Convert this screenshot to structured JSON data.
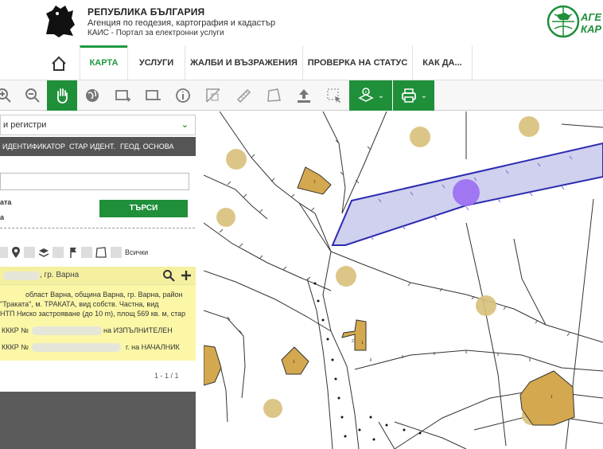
{
  "header": {
    "line1": "РЕПУБЛИКА БЪЛГАРИЯ",
    "line2": "Агенция по геодезия, картография и кадастър",
    "line3": "КАИС - Портал за електронни услуги",
    "brand_text_1": "АГЕ",
    "brand_text_2": "КАР"
  },
  "nav": {
    "items": [
      {
        "label": "КАРТА"
      },
      {
        "label": "УСЛУГИ"
      },
      {
        "label": "ЖАЛБИ И ВЪЗРАЖЕНИЯ"
      },
      {
        "label": "ПРОВЕРКА НА СТАТУС"
      },
      {
        "label": "КАК ДА..."
      }
    ]
  },
  "panel": {
    "dropdown": "и регистри",
    "tabs": [
      "ИДЕНТИФИКАТОР",
      "СТАР ИДЕНТ.",
      "ГЕОД. ОСНОВА"
    ],
    "radio1": "ата",
    "radio2": "а",
    "search_button": "ТЪРСИ",
    "all_label": "Всички",
    "result_title": ", гр. Варна",
    "result_lines": [
      "област Варна, община Варна, гр. Варна, район",
      "\"Траката\", м. ТРАКАТА, вид собств. Частна, вид",
      "НТП Ниско застрояване (до 10 m), площ 569 кв. м, стар"
    ],
    "kkkr1_prefix": "КККР №",
    "kkkr1_suffix": "на ИЗПЪЛНИТЕЛЕН",
    "kkkr2_prefix": "КККР №",
    "kkkr2_suffix": "г. на НАЧАЛНИК",
    "pager": "1 - 1 / 1"
  },
  "colors": {
    "accent": "#1f8f3a",
    "highlight": "#fbf7a7",
    "parcel_fill": "#c8c8ec",
    "parcel_stroke": "#2b2bb0",
    "tree": "#d8c07a",
    "building": "#d4a84e",
    "marker": "#9b6cf2"
  },
  "icons": [
    "zoom-in-icon",
    "zoom-out-icon",
    "pan-hand-icon",
    "globe-icon",
    "add-area-icon",
    "remove-area-icon",
    "info-icon",
    "measure-area-icon",
    "ruler-icon",
    "polygon-icon",
    "upload-icon",
    "select-icon",
    "layers-info-icon",
    "print-icon"
  ]
}
